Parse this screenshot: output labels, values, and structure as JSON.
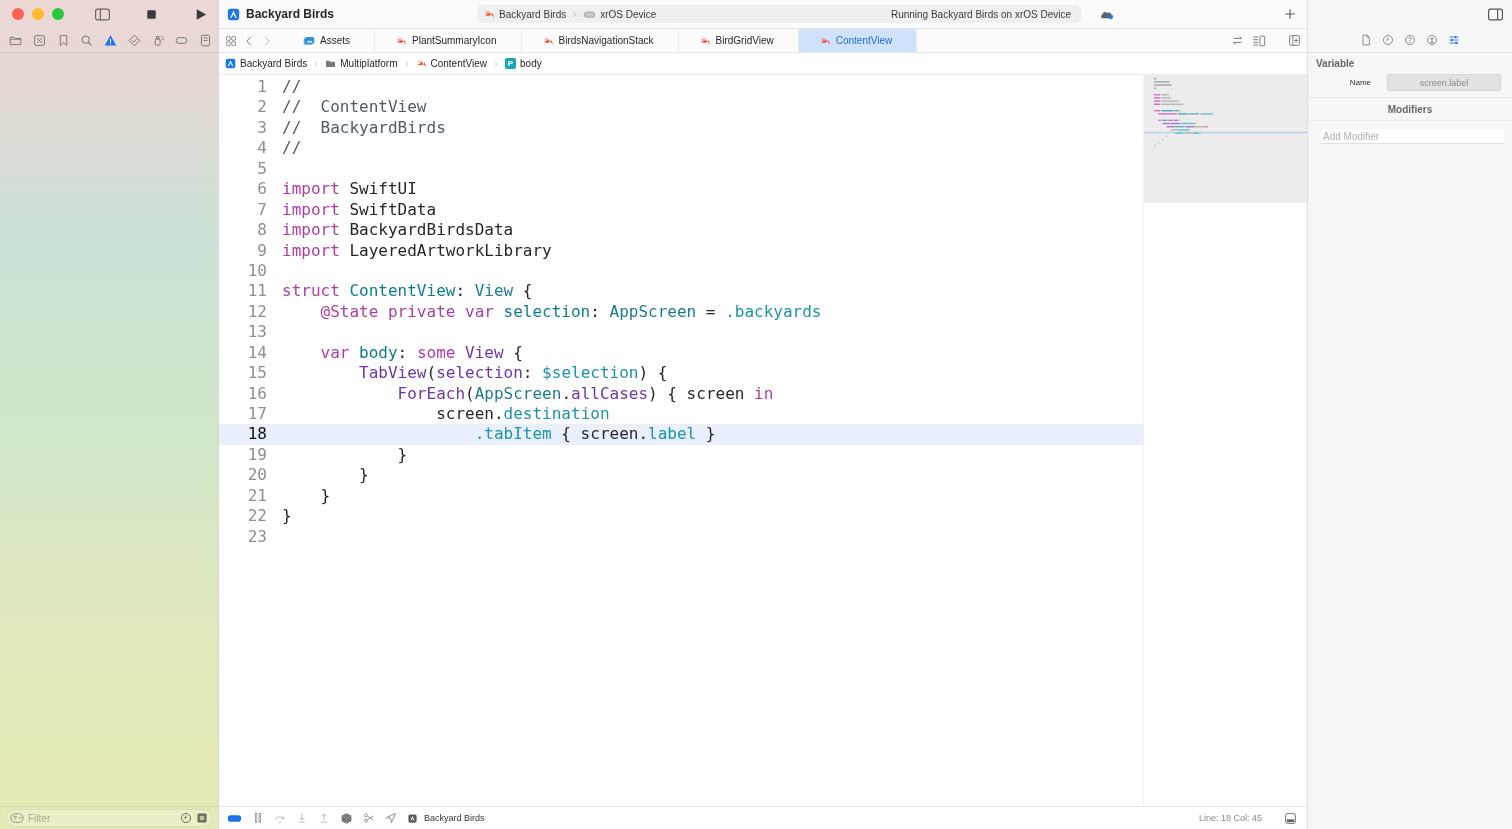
{
  "window": {
    "title": "Backyard Birds"
  },
  "toolbar": {
    "scheme": "Backyard Birds",
    "destination": "xrOS Device",
    "activity": "Running Backyard Birds on xrOS Device"
  },
  "navigator_tabs": [
    {
      "kind": "folder",
      "selected": false
    },
    {
      "kind": "xbox",
      "selected": false
    },
    {
      "kind": "bookmark",
      "selected": false
    },
    {
      "kind": "search",
      "selected": false
    },
    {
      "kind": "warning",
      "selected": true
    },
    {
      "kind": "diamond",
      "selected": false
    },
    {
      "kind": "spray",
      "selected": false
    },
    {
      "kind": "capsule",
      "selected": false
    },
    {
      "kind": "document",
      "selected": false
    }
  ],
  "sidebar": {
    "filter_placeholder": "Filter"
  },
  "tabs": [
    {
      "label": "Assets",
      "kind": "assets",
      "selected": false
    },
    {
      "label": "PlantSummaryIcon",
      "kind": "swift",
      "selected": false
    },
    {
      "label": "BirdsNavigationStack",
      "kind": "swift",
      "selected": false
    },
    {
      "label": "BirdGridView",
      "kind": "swift",
      "selected": false
    },
    {
      "label": "ContentView",
      "kind": "swift",
      "selected": true
    }
  ],
  "breadcrumb": [
    {
      "label": "Backyard Birds",
      "kind": "app"
    },
    {
      "label": "Multiplatform",
      "kind": "folder"
    },
    {
      "label": "ContentView",
      "kind": "swift"
    },
    {
      "label": "body",
      "kind": "property",
      "badge": "P"
    }
  ],
  "editor": {
    "lines": [
      {
        "number": "1",
        "current": false,
        "tokens": [
          {
            "kind": "comment",
            "text": "//"
          }
        ]
      },
      {
        "number": "2",
        "current": false,
        "tokens": [
          {
            "kind": "comment",
            "text": "//  ContentView"
          }
        ]
      },
      {
        "number": "3",
        "current": false,
        "tokens": [
          {
            "kind": "comment",
            "text": "//  BackyardBirds"
          }
        ]
      },
      {
        "number": "4",
        "current": false,
        "tokens": [
          {
            "kind": "comment",
            "text": "//"
          }
        ]
      },
      {
        "number": "5",
        "current": false
      },
      {
        "number": "6",
        "current": false,
        "tokens": [
          {
            "kind": "keyword",
            "text": "import"
          },
          {
            "kind": "plain",
            "text": " SwiftUI"
          }
        ]
      },
      {
        "number": "7",
        "current": false,
        "tokens": [
          {
            "kind": "keyword",
            "text": "import"
          },
          {
            "kind": "plain",
            "text": " SwiftData"
          }
        ]
      },
      {
        "number": "8",
        "current": false,
        "tokens": [
          {
            "kind": "keyword",
            "text": "import"
          },
          {
            "kind": "plain",
            "text": " BackyardBirdsData"
          }
        ]
      },
      {
        "number": "9",
        "current": false,
        "tokens": [
          {
            "kind": "keyword",
            "text": "import"
          },
          {
            "kind": "plain",
            "text": " LayeredArtworkLibrary"
          }
        ]
      },
      {
        "number": "10",
        "current": false
      },
      {
        "number": "11",
        "current": false,
        "tokens": [
          {
            "kind": "keyword",
            "text": "struct"
          },
          {
            "kind": "declaration",
            "text": " ContentView"
          },
          {
            "kind": "plain",
            "text": ": "
          },
          {
            "kind": "type",
            "text": "View"
          },
          {
            "kind": "plain",
            "text": " {"
          }
        ]
      },
      {
        "number": "12",
        "current": false,
        "tokens": [
          {
            "kind": "keyword",
            "text": "    @State private var"
          },
          {
            "kind": "declaration",
            "text": " selection"
          },
          {
            "kind": "plain",
            "text": ": "
          },
          {
            "kind": "type",
            "text": "AppScreen"
          },
          {
            "kind": "plain",
            "text": " = "
          },
          {
            "kind": "member",
            "text": ".backyards"
          }
        ]
      },
      {
        "number": "13",
        "current": false
      },
      {
        "number": "14",
        "current": false,
        "tokens": [
          {
            "kind": "keyword",
            "text": "    var"
          },
          {
            "kind": "declaration",
            "text": " body"
          },
          {
            "kind": "plain",
            "text": ": "
          },
          {
            "kind": "keyword",
            "text": "some"
          },
          {
            "kind": "system",
            "text": " View"
          },
          {
            "kind": "plain",
            "text": " {"
          }
        ]
      },
      {
        "number": "15",
        "current": false,
        "tokens": [
          {
            "kind": "system",
            "text": "        TabView"
          },
          {
            "kind": "plain",
            "text": "("
          },
          {
            "kind": "system",
            "text": "selection"
          },
          {
            "kind": "plain",
            "text": ": "
          },
          {
            "kind": "member",
            "text": "$selection"
          },
          {
            "kind": "plain",
            "text": ") {"
          }
        ]
      },
      {
        "number": "16",
        "current": false,
        "tokens": [
          {
            "kind": "system",
            "text": "            ForEach"
          },
          {
            "kind": "plain",
            "text": "("
          },
          {
            "kind": "type",
            "text": "AppScreen"
          },
          {
            "kind": "plain",
            "text": "."
          },
          {
            "kind": "system",
            "text": "allCases"
          },
          {
            "kind": "plain",
            "text": ") { screen "
          },
          {
            "kind": "keyword",
            "text": "in"
          }
        ]
      },
      {
        "number": "17",
        "current": false,
        "tokens": [
          {
            "kind": "plain",
            "text": "                screen."
          },
          {
            "kind": "member",
            "text": "destination"
          }
        ]
      },
      {
        "number": "18",
        "current": true,
        "tokens": [
          {
            "kind": "member",
            "text": "                    .tabItem"
          },
          {
            "kind": "plain",
            "text": " { screen."
          },
          {
            "kind": "member",
            "text": "label"
          },
          {
            "kind": "plain",
            "text": " }"
          }
        ]
      },
      {
        "number": "19",
        "current": false,
        "tokens": [
          {
            "kind": "plain",
            "text": "            }"
          }
        ]
      },
      {
        "number": "20",
        "current": false,
        "tokens": [
          {
            "kind": "plain",
            "text": "        }"
          }
        ]
      },
      {
        "number": "21",
        "current": false,
        "tokens": [
          {
            "kind": "plain",
            "text": "    }"
          }
        ]
      },
      {
        "number": "22",
        "current": false,
        "tokens": [
          {
            "kind": "plain",
            "text": "}"
          }
        ]
      },
      {
        "number": "23",
        "current": false
      }
    ]
  },
  "debug_bar": {
    "breakpoints_active": true,
    "target": "Backyard Birds",
    "line": "Line: 18",
    "column": "Col: 45"
  },
  "inspector": {
    "tabs": [
      {
        "kind": "file",
        "selected": false
      },
      {
        "kind": "clock",
        "selected": false
      },
      {
        "kind": "help",
        "selected": false
      },
      {
        "kind": "upload",
        "selected": false
      },
      {
        "kind": "sliders",
        "selected": true
      }
    ],
    "section": "Variable",
    "name_label": "Name",
    "name_value": "screen.label",
    "modifiers_title": "Modifiers",
    "modifier_placeholder": "Add Modifier"
  }
}
